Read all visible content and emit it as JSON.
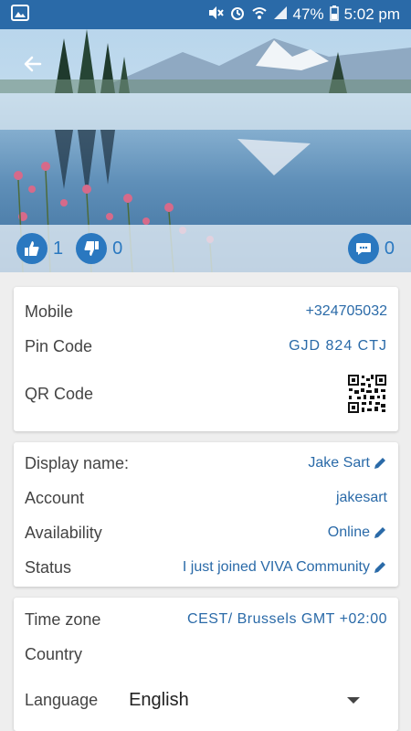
{
  "status_bar": {
    "battery": "47%",
    "time": "5:02 pm"
  },
  "reactions": {
    "likes": "1",
    "dislikes": "0",
    "comments": "0"
  },
  "contact_card": {
    "mobile_label": "Mobile",
    "mobile_value": "+324705032",
    "pin_label": "Pin Code",
    "pin_value": "GJD 824 CTJ",
    "qr_label": "QR Code"
  },
  "profile_card": {
    "display_name_label": "Display name:",
    "display_name_value": "Jake Sart",
    "account_label": "Account",
    "account_value": "jakesart",
    "availability_label": "Availability",
    "availability_value": "Online",
    "status_label": "Status",
    "status_value": "I just joined VIVA Community"
  },
  "locale_card": {
    "timezone_label": "Time zone",
    "timezone_value": "CEST/ Brussels GMT +02:00",
    "country_label": "Country",
    "language_label": "Language",
    "language_value": "English"
  },
  "colors": {
    "status_bar": "#2a6aa8",
    "accent": "#2a78c0",
    "link_text": "#2a6aa8"
  }
}
